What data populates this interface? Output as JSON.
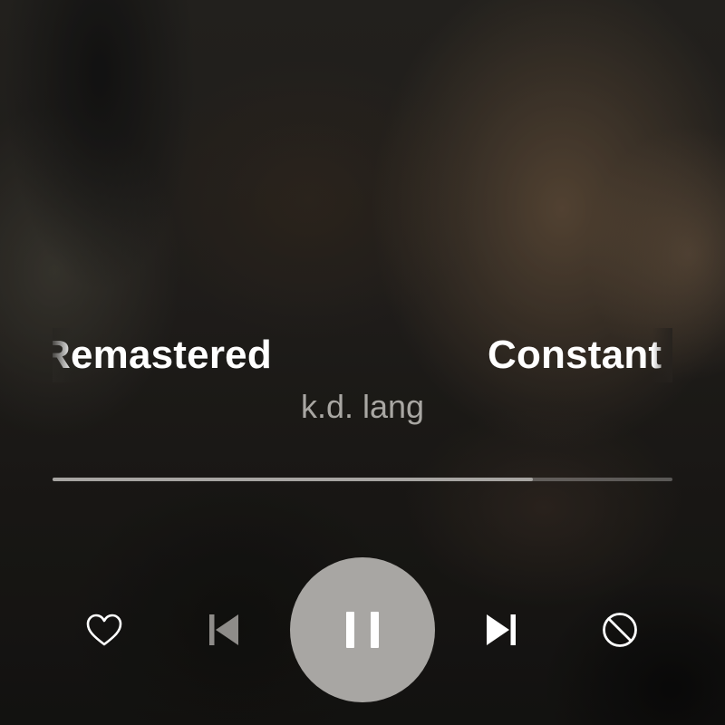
{
  "now_playing": {
    "title_scroll_left": "Remastered",
    "title_scroll_right": "Constant",
    "artist": "k.d. lang",
    "progress_fraction": 0.775
  },
  "controls": {
    "like": {
      "icon": "heart-icon"
    },
    "previous": {
      "icon": "skip-previous-icon",
      "state": "disabled"
    },
    "play_pause": {
      "icon": "pause-icon",
      "state": "playing"
    },
    "next": {
      "icon": "skip-next-icon"
    },
    "block": {
      "icon": "block-icon"
    }
  },
  "colors": {
    "title": "#ffffff",
    "artist": "#a9a7a3",
    "progress_fill": "#a7a5a2",
    "play_button_bg": "#a8a6a3"
  }
}
